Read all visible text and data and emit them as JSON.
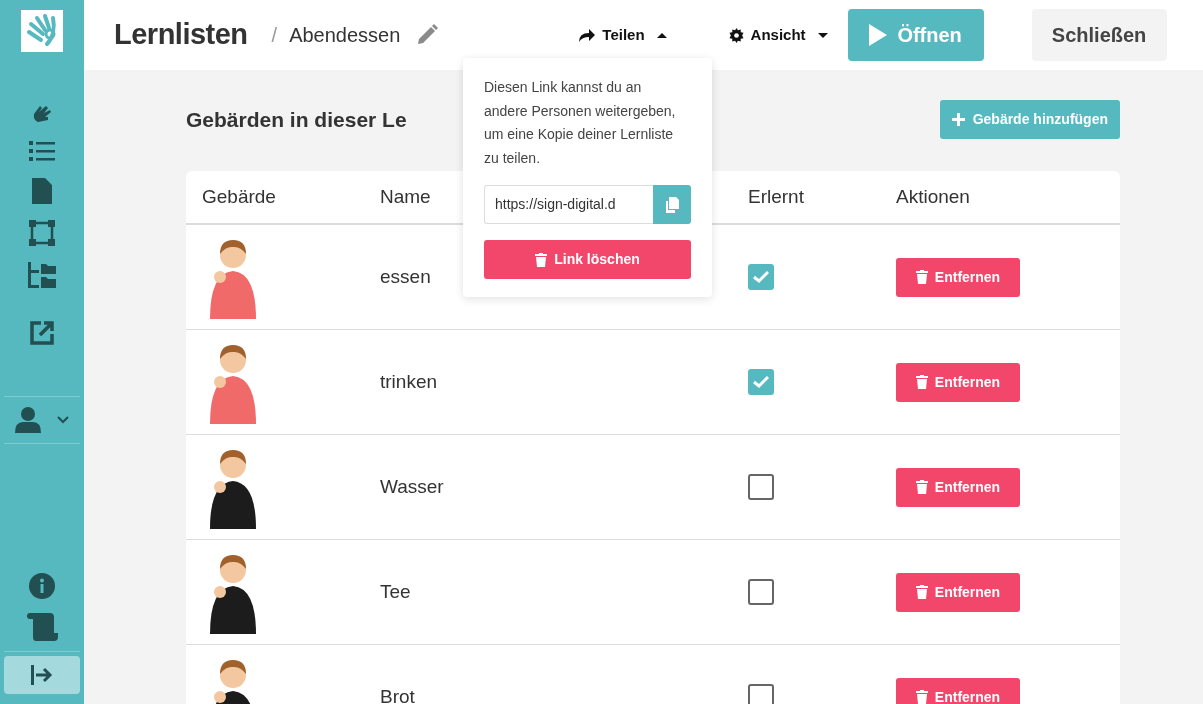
{
  "header": {
    "title": "Lernlisten",
    "separator": "/",
    "list_name": "Abendessen",
    "menus": [
      {
        "label": "Teilen",
        "kind": "share",
        "expanded": true
      },
      {
        "label": "Ansicht",
        "kind": "view",
        "expanded": false
      }
    ],
    "open_button": "Öffnen",
    "close_button": "Schließen"
  },
  "share_popover": {
    "text": "Diesen Link kannst du an andere Personen weitergeben, um eine Kopie deiner Lernliste zu teilen.",
    "link_value": "https://sign-digital.d",
    "delete_button": "Link löschen"
  },
  "section": {
    "title": "Gebärden in dieser Le",
    "add_button": "Gebärde hinzufügen"
  },
  "table": {
    "columns": [
      "Gebärde",
      "Name",
      "Erlernt",
      "Aktionen"
    ],
    "rows": [
      {
        "name": "essen",
        "learned": true,
        "color": "#f06a6a",
        "action": "Entfernen"
      },
      {
        "name": "trinken",
        "learned": true,
        "color": "#f06a6a",
        "action": "Entfernen"
      },
      {
        "name": "Wasser",
        "learned": false,
        "color": "#1c1c1c",
        "action": "Entfernen"
      },
      {
        "name": "Tee",
        "learned": false,
        "color": "#1c1c1c",
        "action": "Entfernen"
      },
      {
        "name": "Brot",
        "learned": false,
        "color": "#1c1c1c",
        "action": "Entfernen"
      }
    ]
  }
}
